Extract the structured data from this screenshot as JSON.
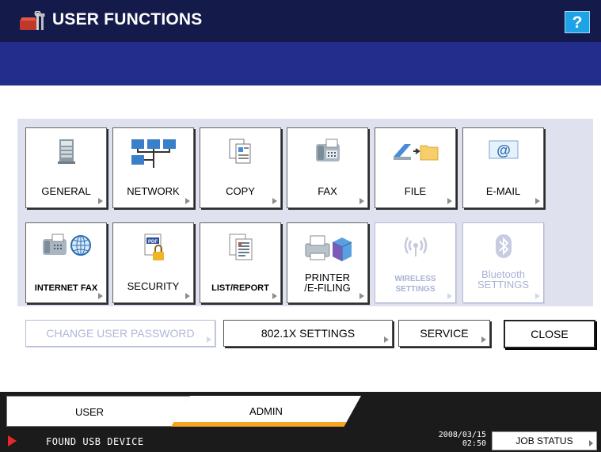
{
  "header": {
    "title": "USER FUNCTIONS",
    "help_label": "?",
    "icon": "tools-icon"
  },
  "tiles_row1": [
    {
      "label": "GENERAL",
      "icon": "copier-icon",
      "enabled": true
    },
    {
      "label": "NETWORK",
      "icon": "network-icon",
      "enabled": true
    },
    {
      "label": "COPY",
      "icon": "copy-documents-icon",
      "enabled": true
    },
    {
      "label": "FAX",
      "icon": "fax-icon",
      "enabled": true
    },
    {
      "label": "FILE",
      "icon": "scan-to-folder-icon",
      "enabled": true
    },
    {
      "label": "E-MAIL",
      "icon": "email-icon",
      "enabled": true
    }
  ],
  "tiles_row2": [
    {
      "label": "INTERNET FAX",
      "icon": "internet-fax-icon",
      "enabled": true
    },
    {
      "label": "SECURITY",
      "icon": "pdf-lock-icon",
      "enabled": true
    },
    {
      "label": "LIST/REPORT",
      "icon": "list-report-icon",
      "enabled": true
    },
    {
      "label_line1": "PRINTER",
      "label_line2": "/E-FILING",
      "icon": "printer-box-icon",
      "enabled": true
    },
    {
      "label_line1": "WIRELESS",
      "label_line2": "SETTINGS",
      "icon": "wireless-icon",
      "enabled": false
    },
    {
      "label_line1": "Bluetooth",
      "label_line2": "SETTINGS",
      "icon": "bluetooth-icon",
      "enabled": false
    }
  ],
  "buttons": {
    "change_password": "CHANGE USER PASSWORD",
    "dot1x": "802.1X SETTINGS",
    "service": "SERVICE",
    "close": "CLOSE"
  },
  "tabs": {
    "user": "USER",
    "admin": "ADMIN"
  },
  "status": {
    "message": "FOUND USB DEVICE",
    "date": "2008/03/15",
    "time": "02:50",
    "job_status": "JOB STATUS"
  },
  "colors": {
    "title_bar": "#141b4a",
    "sub_bar": "#232d8c",
    "panel": "#dfe1ef",
    "help": "#1ea4e6",
    "admin_accent": "#f5a623",
    "status_arrow": "#e8262b"
  }
}
